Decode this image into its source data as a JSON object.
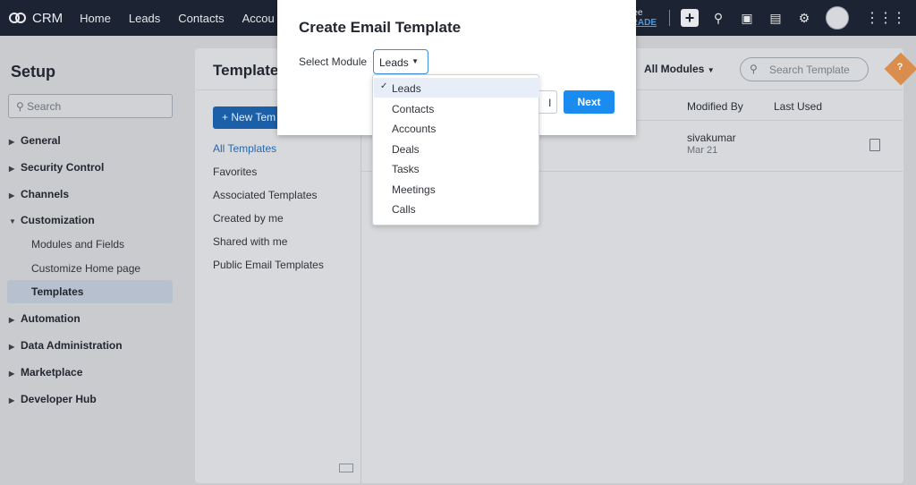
{
  "topnav": {
    "logo": "CRM",
    "items": [
      "Home",
      "Leads",
      "Contacts",
      "Accou"
    ],
    "upgrade_line1": "Free",
    "upgrade_line2": "GRADE"
  },
  "setup": {
    "title": "Setup",
    "search_placeholder": "Search",
    "sections": [
      {
        "label": "General"
      },
      {
        "label": "Security Control"
      },
      {
        "label": "Channels"
      },
      {
        "label": "Customization"
      },
      {
        "label": "Automation"
      },
      {
        "label": "Data Administration"
      },
      {
        "label": "Marketplace"
      },
      {
        "label": "Developer Hub"
      }
    ],
    "customization_items": [
      "Modules and Fields",
      "Customize Home page",
      "Templates"
    ]
  },
  "templates": {
    "title": "Template",
    "new_button": "+ New Tem",
    "links": [
      "All Templates",
      "Favorites",
      "Associated Templates",
      "Created by me",
      "Shared with me",
      "Public Email Templates"
    ],
    "filter": "All Modules",
    "search_placeholder": "Search Template",
    "columns": {
      "modified_by": "Modified By",
      "last_used": "Last Used"
    },
    "row": {
      "modified_by": "sivakumar",
      "modified_date": "Mar 21"
    },
    "help": "?"
  },
  "modal": {
    "title": "Create Email Template",
    "select_label": "Select Module",
    "selected_module": "Leads",
    "cancel_partial": "l",
    "next": "Next",
    "options": [
      "Leads",
      "Contacts",
      "Accounts",
      "Deals",
      "Tasks",
      "Meetings",
      "Calls"
    ]
  }
}
